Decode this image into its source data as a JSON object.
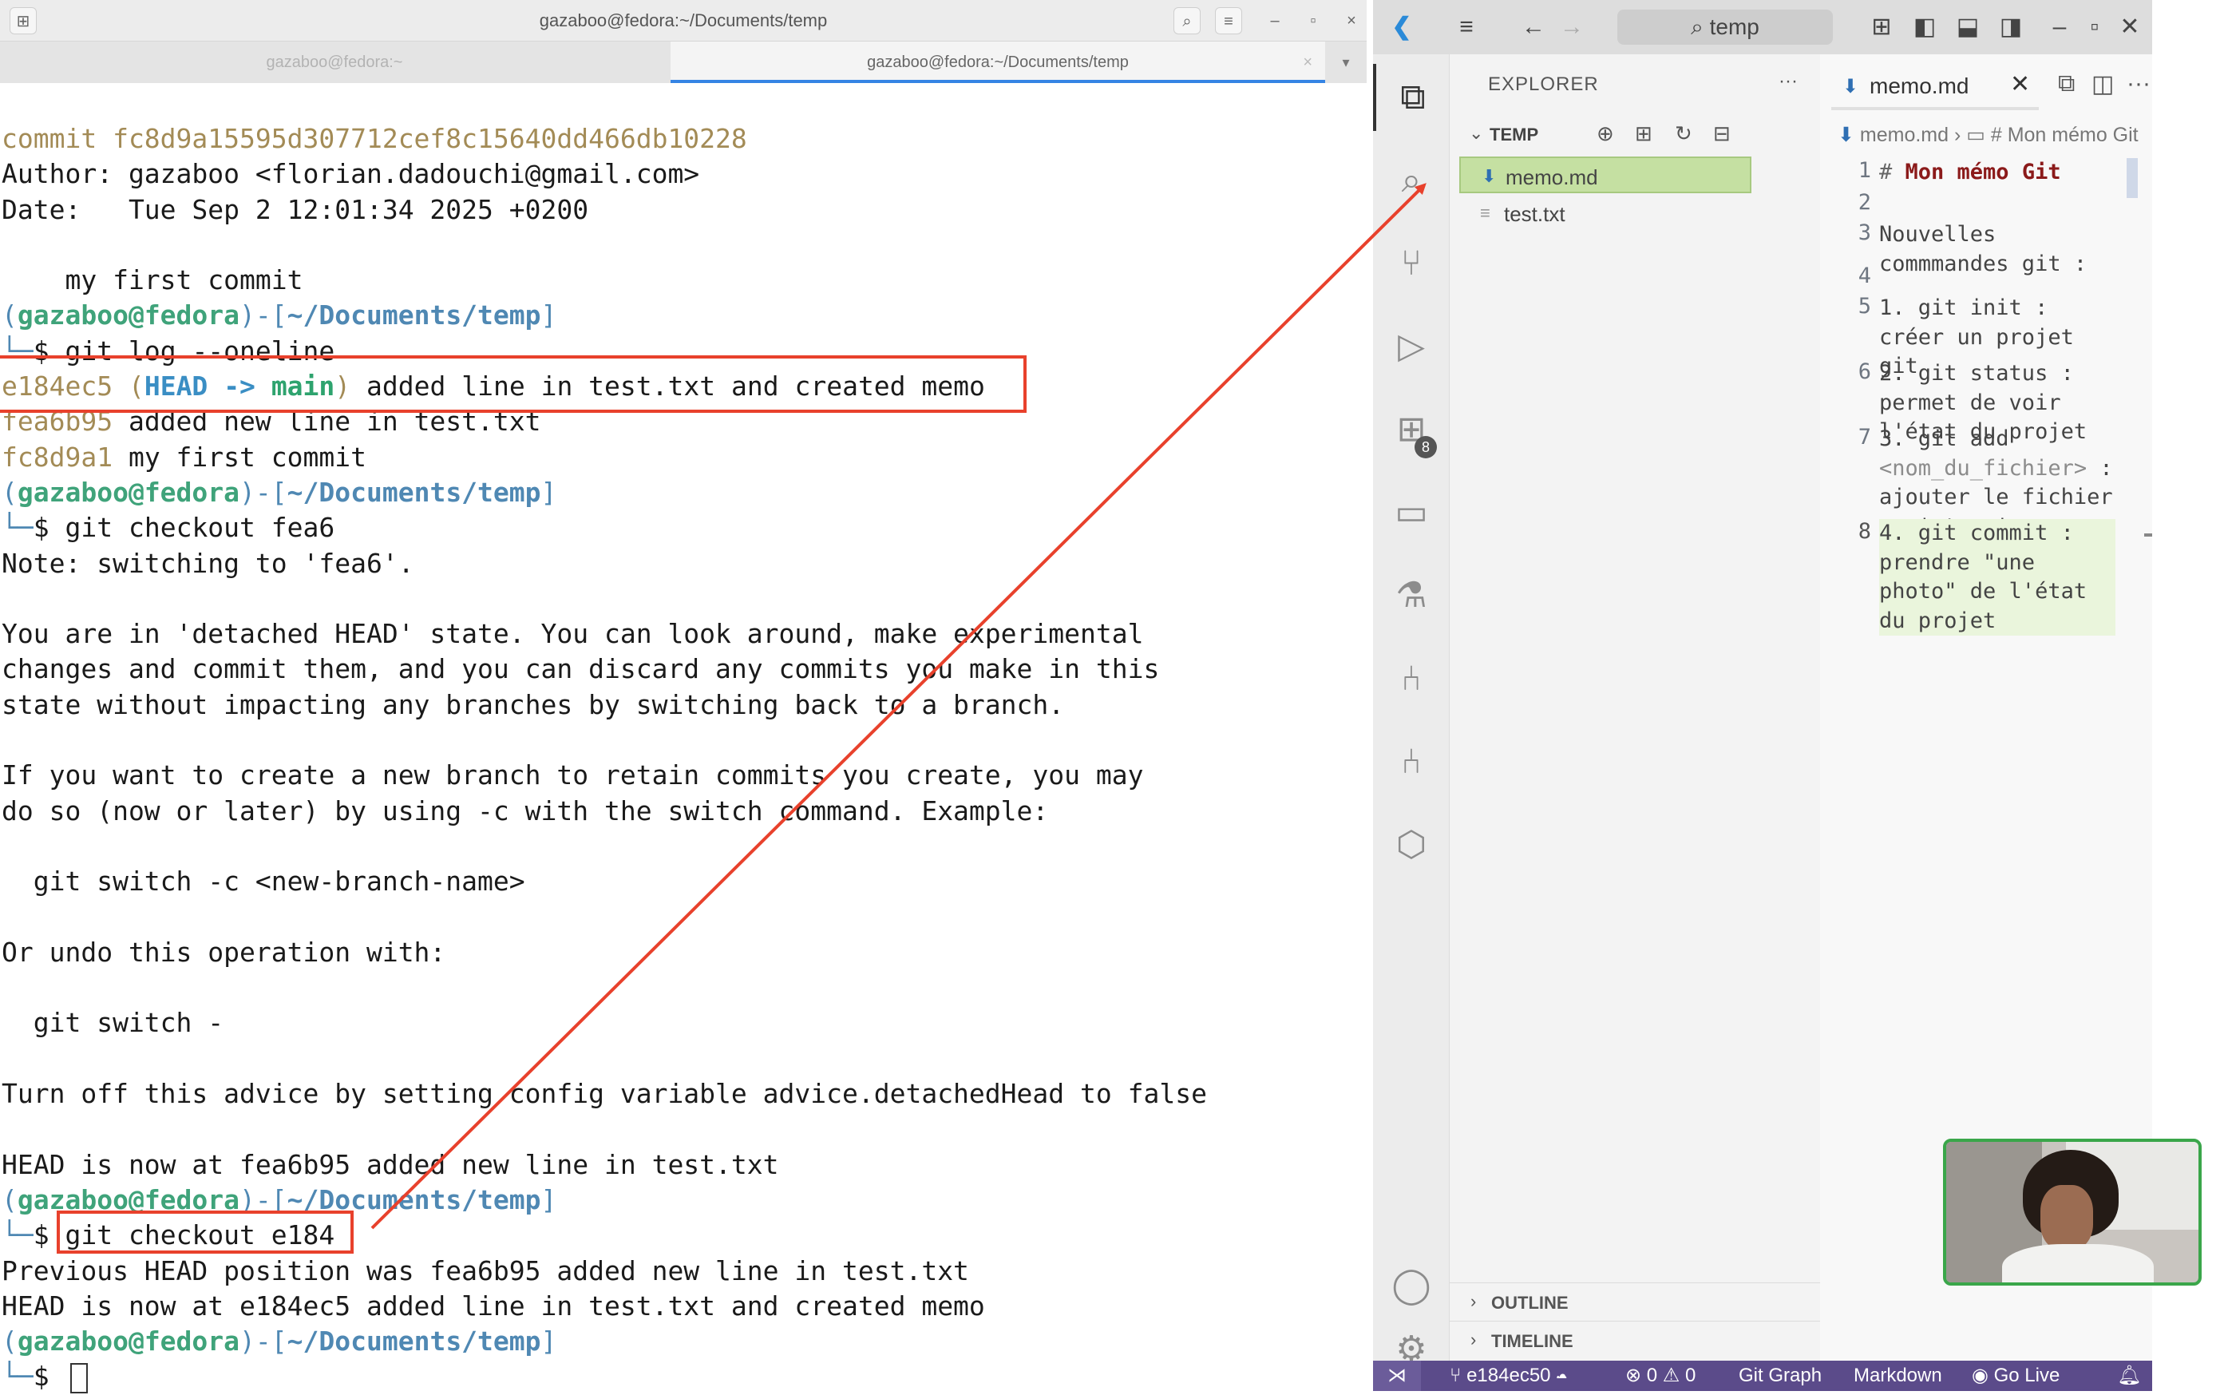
{
  "terminal": {
    "window_title": "gazaboo@fedora:~/Documents/temp",
    "tabs": [
      "gazaboo@fedora:~",
      "gazaboo@fedora:~/Documents/temp"
    ],
    "close_glyph": "×",
    "prompt": {
      "user": "gazaboo@fedora",
      "path": "~/Documents/temp"
    },
    "lines": [
      {
        "kind": "commit",
        "text": "commit fc8d9a15595d307712cef8c15640dd466db10228"
      },
      {
        "kind": "plain",
        "text": "Author: gazaboo <florian.dadouchi@gmail.com>"
      },
      {
        "kind": "plain",
        "text": "Date:   Tue Sep 2 12:01:34 2025 +0200"
      },
      {
        "kind": "blank",
        "text": ""
      },
      {
        "kind": "plain",
        "text": "    my first commit"
      },
      {
        "kind": "prompt"
      },
      {
        "kind": "cmd",
        "text": "git log --oneline"
      },
      {
        "kind": "log",
        "hash": "e184ec5",
        "decoration": true,
        "msg": " added line in test.txt and created memo"
      },
      {
        "kind": "log",
        "hash": "fea6b95",
        "msg": " added new line in test.txt"
      },
      {
        "kind": "log",
        "hash": "fc8d9a1",
        "msg": " my first commit"
      },
      {
        "kind": "prompt"
      },
      {
        "kind": "cmd",
        "text": "git checkout fea6"
      },
      {
        "kind": "plain",
        "text": "Note: switching to 'fea6'."
      },
      {
        "kind": "blank",
        "text": ""
      },
      {
        "kind": "plain",
        "text": "You are in 'detached HEAD' state. You can look around, make experimental"
      },
      {
        "kind": "plain",
        "text": "changes and commit them, and you can discard any commits you make in this"
      },
      {
        "kind": "plain",
        "text": "state without impacting any branches by switching back to a branch."
      },
      {
        "kind": "blank",
        "text": ""
      },
      {
        "kind": "plain",
        "text": "If you want to create a new branch to retain commits you create, you may"
      },
      {
        "kind": "plain",
        "text": "do so (now or later) by using -c with the switch command. Example:"
      },
      {
        "kind": "blank",
        "text": ""
      },
      {
        "kind": "plain",
        "text": "  git switch -c <new-branch-name>"
      },
      {
        "kind": "blank",
        "text": ""
      },
      {
        "kind": "plain",
        "text": "Or undo this operation with:"
      },
      {
        "kind": "blank",
        "text": ""
      },
      {
        "kind": "plain",
        "text": "  git switch -"
      },
      {
        "kind": "blank",
        "text": ""
      },
      {
        "kind": "plain",
        "text": "Turn off this advice by setting config variable advice.detachedHead to false"
      },
      {
        "kind": "blank",
        "text": ""
      },
      {
        "kind": "plain",
        "text": "HEAD is now at fea6b95 added new line in test.txt"
      },
      {
        "kind": "prompt"
      },
      {
        "kind": "cmd",
        "text": "git checkout e184"
      },
      {
        "kind": "plain",
        "text": "Previous HEAD position was fea6b95 added new line in test.txt"
      },
      {
        "kind": "plain",
        "text": "HEAD is now at e184ec5 added line in test.txt and created memo"
      },
      {
        "kind": "prompt"
      },
      {
        "kind": "cmd_cursor",
        "text": ""
      }
    ],
    "decoration": {
      "head": "HEAD",
      "arrow": "->",
      "branch": "main"
    }
  },
  "vscode": {
    "search_label": "temp",
    "explorer": {
      "title": "EXPLORER",
      "more": "···",
      "folder": "TEMP",
      "files": [
        {
          "name": "memo.md",
          "icon": "markdown-icon",
          "selected": true
        },
        {
          "name": "test.txt",
          "icon": "text-file-icon",
          "selected": false
        }
      ],
      "outline": "OUTLINE",
      "timeline": "TIMELINE"
    },
    "extensions_badge": "8",
    "editor": {
      "tab_label": "memo.md",
      "tab_close": "✕",
      "breadcrumb": [
        "memo.md",
        "# Mon mémo Git"
      ],
      "lines": [
        {
          "n": "1",
          "text": "Mon mémo Git",
          "hash": "# ",
          "kind": "h1"
        },
        {
          "n": "2",
          "text": ""
        },
        {
          "n": "3",
          "text": "Nouvelles commmandes git :"
        },
        {
          "n": "4",
          "text": ""
        },
        {
          "n": "5",
          "text": "1. git init : créer un projet git"
        },
        {
          "n": "6",
          "text": "2. git status : permet de voir l'état du projet"
        },
        {
          "n": "7",
          "text": "3. git add ",
          "angle": "<nom_du_fichier>",
          "after": " : ajouter le fichier en 'stage'"
        },
        {
          "n": "8",
          "text": "4. git commit : prendre \"une photo\" de l'état du projet",
          "kind": "current"
        }
      ]
    },
    "statusbar": {
      "branch": "e184ec50",
      "problems": "⊗ 0 ⚠ 0",
      "git_graph": "Git Graph",
      "language": "Markdown",
      "go_live": "Go Live"
    }
  },
  "colors": {
    "highlight": "#e8412c",
    "status_bar": "#5b4b8a",
    "selection": "#c5e0a2"
  }
}
